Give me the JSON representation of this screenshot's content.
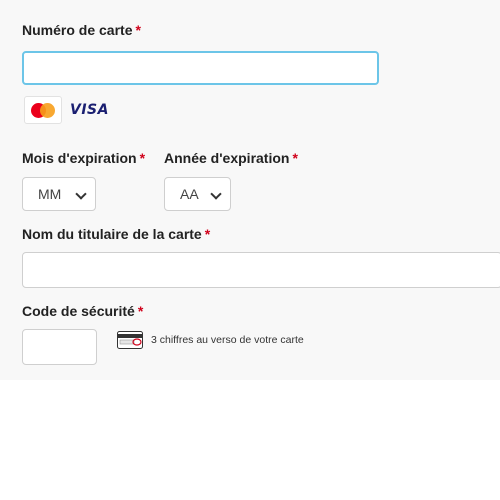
{
  "card_number": {
    "label": "Numéro de carte",
    "required_mark": "*",
    "value": "",
    "placeholder": ""
  },
  "brands": [
    {
      "name": "mastercard-logo"
    },
    {
      "name": "visa-logo",
      "text": "VISA"
    }
  ],
  "expiry": {
    "month_label": "Mois d'expiration",
    "month_required_mark": "*",
    "month_value": "MM",
    "year_label": "Année d'expiration",
    "year_required_mark": "*",
    "year_value": "AA"
  },
  "holder": {
    "label": "Nom du titulaire de la carte",
    "required_mark": "*",
    "value": ""
  },
  "security": {
    "label": "Code de sécurité",
    "required_mark": "*",
    "value": "",
    "hint": "3 chiffres au verso de votre carte",
    "icon": "card-back-icon"
  },
  "colors": {
    "focus_border": "#6cc5e8",
    "required": "#d0021b",
    "panel_bg": "#f8f8f8"
  }
}
